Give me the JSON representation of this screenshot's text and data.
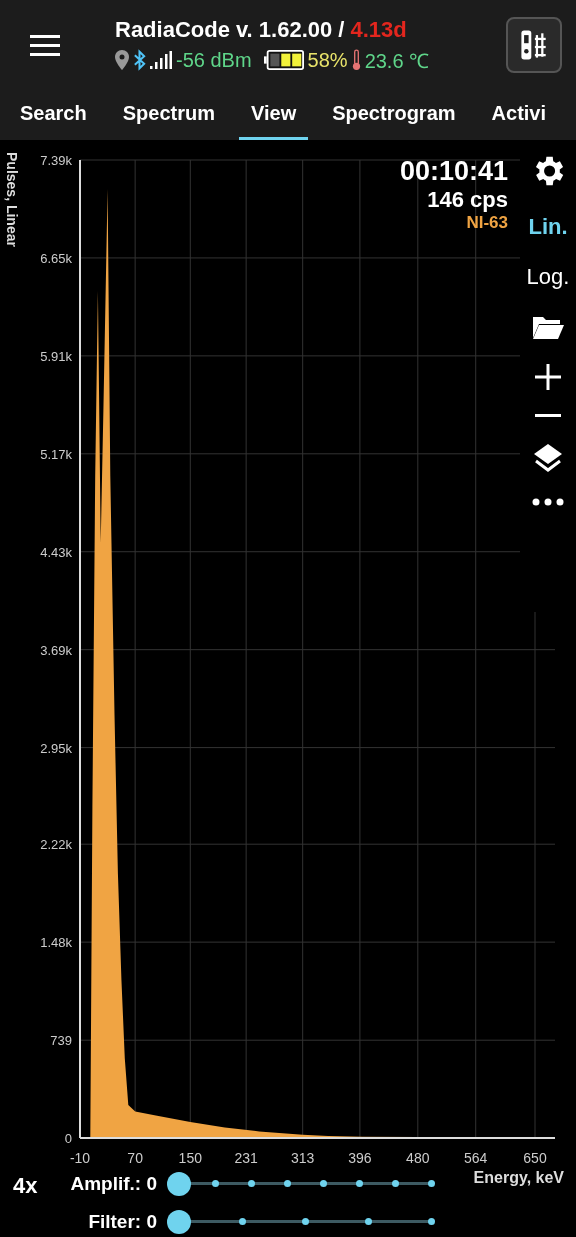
{
  "header": {
    "title": "RadiaCode v. 1.62.00 /",
    "title_suffix": "4.13d",
    "signal": "-56 dBm",
    "battery": "58%",
    "temperature": "23.6 ℃"
  },
  "tabs": [
    {
      "label": "Search",
      "selected": false
    },
    {
      "label": "Spectrum",
      "selected": false
    },
    {
      "label": "View",
      "selected": true
    },
    {
      "label": "Spectrogram",
      "selected": false
    },
    {
      "label": "Activi",
      "selected": false
    }
  ],
  "readout": {
    "time": "00:10:41",
    "rate": "146 cps"
  },
  "scales": [
    {
      "label": "Lin.",
      "selected": true
    },
    {
      "label": "Log.",
      "selected": false
    }
  ],
  "chart_data": {
    "type": "area",
    "xlabel": "Energy, keV",
    "ylabel": "Pulses, Linear",
    "x": [
      -10,
      0,
      5,
      8,
      12,
      16,
      20,
      24,
      30,
      34,
      40,
      45,
      50,
      55,
      60,
      70,
      100,
      150,
      200,
      250,
      313,
      350,
      400,
      480,
      564,
      650
    ],
    "series": [
      {
        "name": "NI-63",
        "color": "#f0a443",
        "values": [
          0,
          0,
          0,
          2500,
          5000,
          6400,
          4500,
          5500,
          7170,
          5000,
          3200,
          2000,
          1200,
          600,
          250,
          200,
          170,
          120,
          80,
          50,
          25,
          15,
          10,
          8,
          5,
          3
        ]
      }
    ],
    "grid": true,
    "xlim": [
      -10,
      650
    ],
    "ylim": [
      0,
      7390
    ],
    "xticks": [
      -10,
      70,
      150,
      231,
      313,
      396,
      480,
      564,
      650
    ],
    "yticks": [
      {
        "value": 0,
        "label": "0"
      },
      {
        "value": 739,
        "label": "739"
      },
      {
        "value": 1480,
        "label": "1.48k"
      },
      {
        "value": 2220,
        "label": "2.22k"
      },
      {
        "value": 2950,
        "label": "2.95k"
      },
      {
        "value": 3690,
        "label": "3.69k"
      },
      {
        "value": 4430,
        "label": "4.43k"
      },
      {
        "value": 5170,
        "label": "5.17k"
      },
      {
        "value": 5910,
        "label": "5.91k"
      },
      {
        "value": 6650,
        "label": "6.65k"
      },
      {
        "value": 7390,
        "label": "7.39k"
      }
    ]
  },
  "gain": "4x",
  "sliders": [
    {
      "label": "Amplif.: 0",
      "level": 0
    },
    {
      "label": "Filter: 0",
      "level": 0
    }
  ]
}
